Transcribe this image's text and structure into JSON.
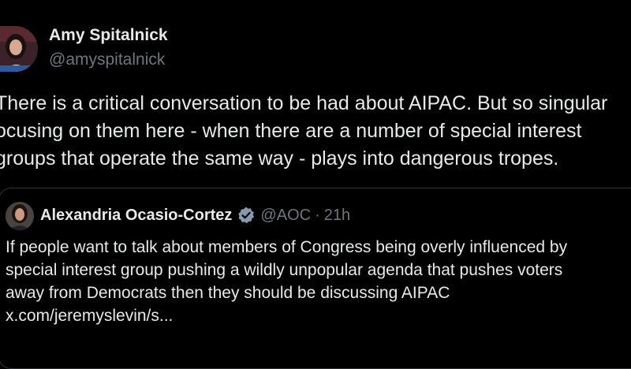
{
  "tweet": {
    "author": {
      "name": "Amy Spitalnick",
      "handle": "@amyspitalnick"
    },
    "text_lines": [
      "There is a critical conversation to be had about AIPAC. But so singular",
      "ocusing on them here - when there are a number of special interest",
      "groups that operate the same way - plays into dangerous tropes."
    ]
  },
  "quoted_tweet": {
    "author": {
      "name": "Alexandria Ocasio-Cortez",
      "handle": "@AOC",
      "separator": "·",
      "time": "21h"
    },
    "text_lines": [
      "If people want to talk about members of Congress being overly influenced by",
      "special interest group pushing a wildly unpopular agenda that pushes voters",
      "away from Democrats then they should be discussing AIPAC",
      "x.com/jeremyslevin/s..."
    ]
  },
  "colors": {
    "background": "#000000",
    "text_primary": "#e7e9ea",
    "text_secondary": "#71767b",
    "border": "#2f3336",
    "verified_badge": "#829aab"
  }
}
